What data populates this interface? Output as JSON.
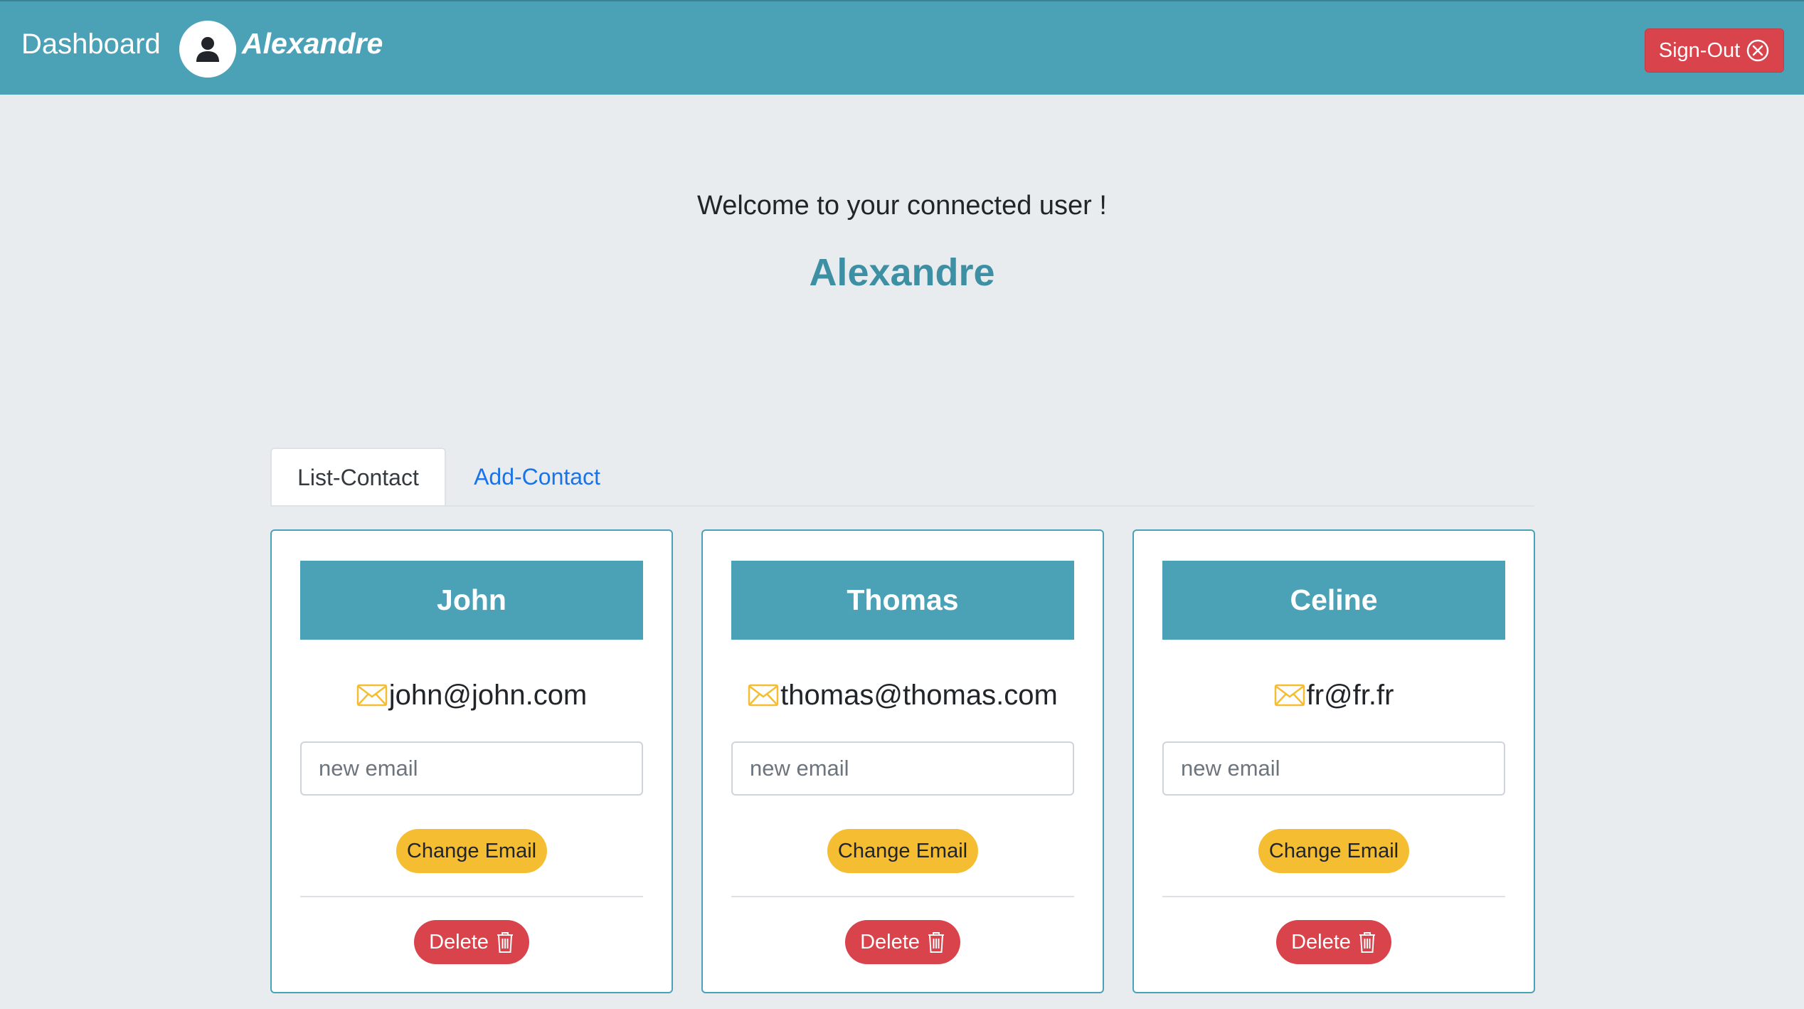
{
  "navbar": {
    "brand": "Dashboard",
    "username": "Alexandre",
    "signout_label": "Sign-Out"
  },
  "welcome": {
    "message": "Welcome to your connected user !",
    "name": "Alexandre"
  },
  "tabs": [
    {
      "label": "List-Contact",
      "active": true
    },
    {
      "label": "Add-Contact",
      "active": false
    }
  ],
  "contacts": [
    {
      "name": "John",
      "email": "john@john.com",
      "input_placeholder": "new email",
      "change_label": "Change Email",
      "delete_label": "Delete"
    },
    {
      "name": "Thomas",
      "email": "thomas@thomas.com",
      "input_placeholder": "new email",
      "change_label": "Change Email",
      "delete_label": "Delete"
    },
    {
      "name": "Celine",
      "email": "fr@fr.fr",
      "input_placeholder": "new email",
      "change_label": "Change Email",
      "delete_label": "Delete"
    }
  ],
  "colors": {
    "navbar": "#4ba2b7",
    "accent_text": "#3d8fa3",
    "danger": "#d9434c",
    "warning": "#f5bd32",
    "link": "#1a73e8",
    "background": "#e9ecef"
  },
  "icons": {
    "avatar": "user-circle-icon",
    "signout": "close-circle-icon",
    "email": "envelope-icon",
    "delete": "trash-icon"
  }
}
